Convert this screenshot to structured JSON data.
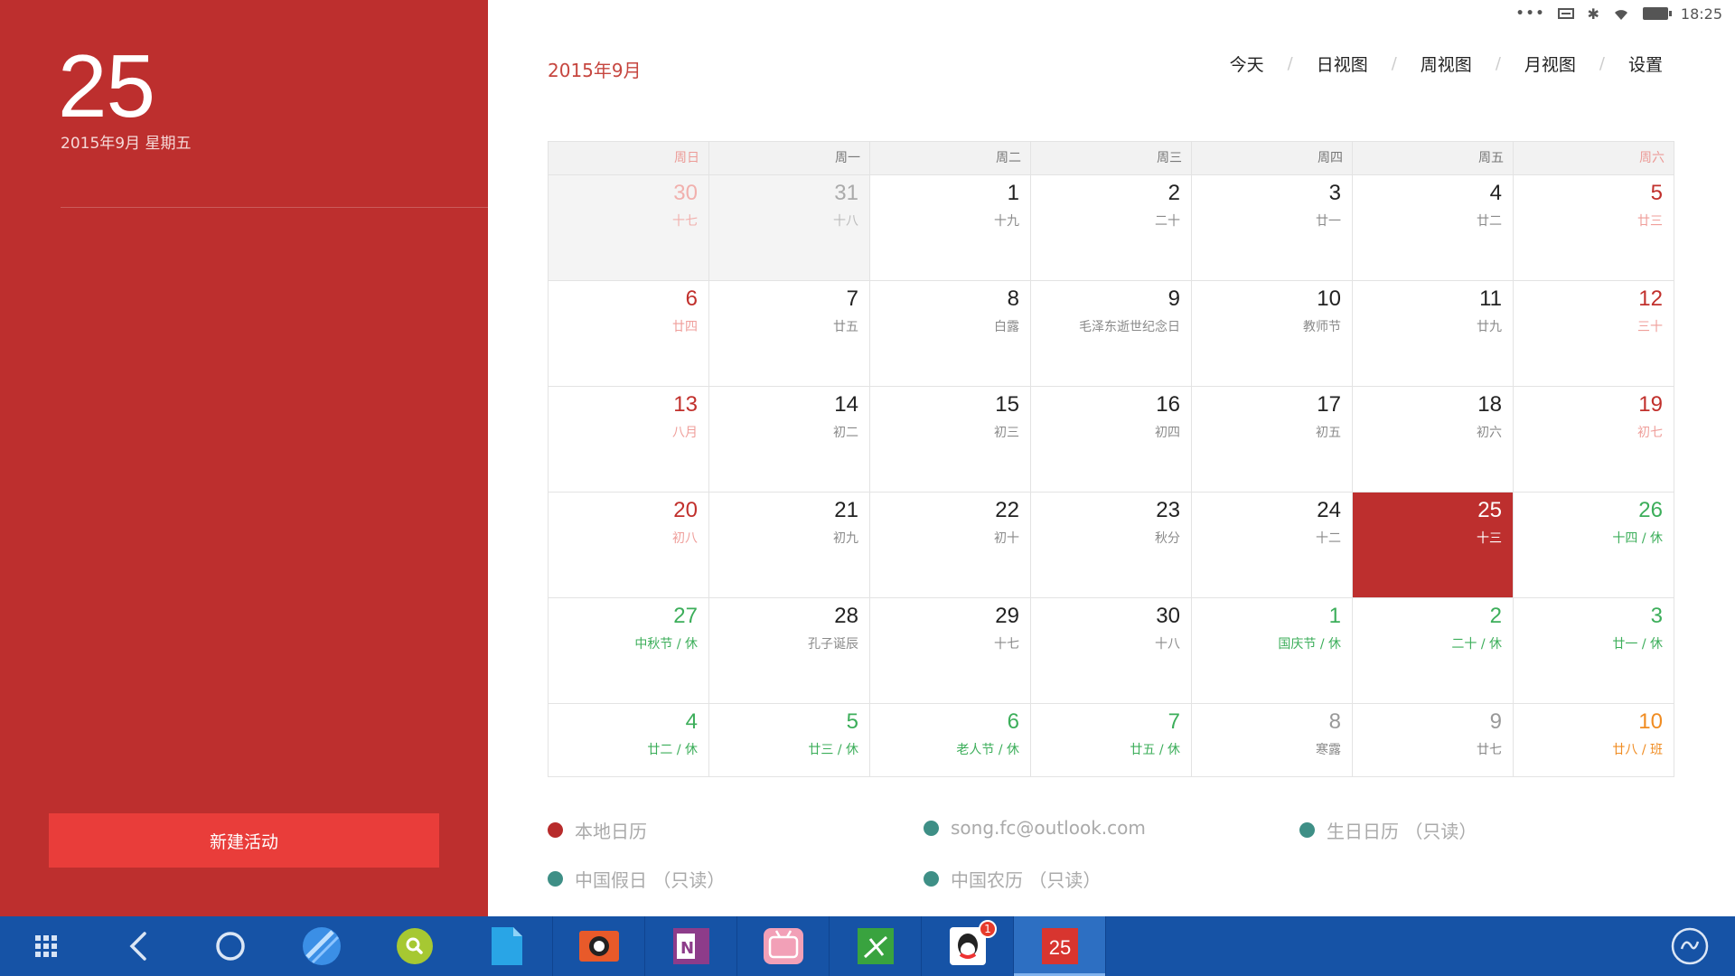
{
  "sidebar": {
    "day_number": "25",
    "date_line": "2015年9月 星期五",
    "new_event_label": "新建活动"
  },
  "status_bar": {
    "time": "18:25"
  },
  "header": {
    "month_title": "2015年9月",
    "views": [
      {
        "label": "今天",
        "id": "today"
      },
      {
        "label": "日视图",
        "id": "day"
      },
      {
        "label": "周视图",
        "id": "week"
      },
      {
        "label": "月视图",
        "id": "month"
      },
      {
        "label": "设置",
        "id": "settings"
      }
    ]
  },
  "calendar": {
    "weekdays": [
      "周日",
      "周一",
      "周二",
      "周三",
      "周四",
      "周五",
      "周六"
    ],
    "weeks": [
      [
        {
          "d": "30",
          "s": "十七",
          "t": "prev wk"
        },
        {
          "d": "31",
          "s": "十八",
          "t": "prev"
        },
        {
          "d": "1",
          "s": "十九",
          "t": ""
        },
        {
          "d": "2",
          "s": "二十",
          "t": ""
        },
        {
          "d": "3",
          "s": "廿一",
          "t": ""
        },
        {
          "d": "4",
          "s": "廿二",
          "t": ""
        },
        {
          "d": "5",
          "s": "廿三",
          "t": "wk"
        }
      ],
      [
        {
          "d": "6",
          "s": "廿四",
          "t": "wk"
        },
        {
          "d": "7",
          "s": "廿五",
          "t": ""
        },
        {
          "d": "8",
          "s": "白露",
          "t": ""
        },
        {
          "d": "9",
          "s": "毛泽东逝世纪念日",
          "t": ""
        },
        {
          "d": "10",
          "s": "教师节",
          "t": ""
        },
        {
          "d": "11",
          "s": "廿九",
          "t": ""
        },
        {
          "d": "12",
          "s": "三十",
          "t": "wk"
        }
      ],
      [
        {
          "d": "13",
          "s": "八月",
          "t": "wk"
        },
        {
          "d": "14",
          "s": "初二",
          "t": ""
        },
        {
          "d": "15",
          "s": "初三",
          "t": ""
        },
        {
          "d": "16",
          "s": "初四",
          "t": ""
        },
        {
          "d": "17",
          "s": "初五",
          "t": ""
        },
        {
          "d": "18",
          "s": "初六",
          "t": ""
        },
        {
          "d": "19",
          "s": "初七",
          "t": "wk"
        }
      ],
      [
        {
          "d": "20",
          "s": "初八",
          "t": "wk"
        },
        {
          "d": "21",
          "s": "初九",
          "t": ""
        },
        {
          "d": "22",
          "s": "初十",
          "t": ""
        },
        {
          "d": "23",
          "s": "秋分",
          "t": ""
        },
        {
          "d": "24",
          "s": "十二",
          "t": ""
        },
        {
          "d": "25",
          "s": "十三",
          "t": "today"
        },
        {
          "d": "26",
          "s": "十四 / 休",
          "t": "hol"
        }
      ],
      [
        {
          "d": "27",
          "s": "中秋节 / 休",
          "t": "hol"
        },
        {
          "d": "28",
          "s": "孔子诞辰",
          "t": ""
        },
        {
          "d": "29",
          "s": "十七",
          "t": ""
        },
        {
          "d": "30",
          "s": "十八",
          "t": ""
        },
        {
          "d": "1",
          "s": "国庆节 / 休",
          "t": "hol"
        },
        {
          "d": "2",
          "s": "二十 / 休",
          "t": "hol"
        },
        {
          "d": "3",
          "s": "廿一 / 休",
          "t": "hol"
        }
      ],
      [
        {
          "d": "4",
          "s": "廿二 / 休",
          "t": "hol"
        },
        {
          "d": "5",
          "s": "廿三 / 休",
          "t": "hol"
        },
        {
          "d": "6",
          "s": "老人节 / 休",
          "t": "hol"
        },
        {
          "d": "7",
          "s": "廿五 / 休",
          "t": "hol"
        },
        {
          "d": "8",
          "s": "寒露",
          "t": "next"
        },
        {
          "d": "9",
          "s": "廿七",
          "t": "next"
        },
        {
          "d": "10",
          "s": "廿八 / 班",
          "t": "work"
        }
      ]
    ]
  },
  "legend": [
    {
      "label": "本地日历",
      "color": "#b72b2b"
    },
    {
      "label": "song.fc@outlook.com",
      "color": "#3e8f86"
    },
    {
      "label": "生日日历 （只读）",
      "color": "#3e8f86"
    },
    {
      "label": "中国假日 （只读）",
      "color": "#3e8f86"
    },
    {
      "label": "中国农历 （只读）",
      "color": "#3e8f86"
    }
  ],
  "taskbar": {
    "calendar_icon_day": "25",
    "qq_badge": "1",
    "apps": [
      "files-app-icon",
      "camera-app-icon",
      "onenote-app-icon",
      "bilibili-app-icon",
      "music-app-icon",
      "qq-app-icon",
      "calendar-app-icon"
    ]
  },
  "colors": {
    "accent_red": "#bd2f2e",
    "button_red": "#e93d3a",
    "holiday_green": "#3cae5a",
    "workday_orange": "#f08c22",
    "taskbar_blue": "#1653a6"
  }
}
